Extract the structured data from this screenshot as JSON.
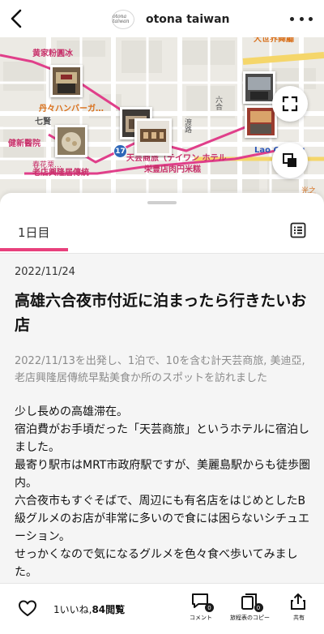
{
  "header": {
    "logo_text": "otona taiwan",
    "brand_name": "otona taiwan"
  },
  "map": {
    "labels": {
      "department_store": "大世界舞廳",
      "chicken_shop": "黄家粉圓冰",
      "burger": "丹々ハンバーガ…",
      "qixian": "七賢",
      "hospital": "健新醫院",
      "cafe_rice": "春花栗…",
      "hotel": "天芸商旅（テイワン ホテル",
      "noodles": "栄豊店肉円米糕",
      "oldshop": "老店興隆居傳統",
      "laochiang": "Lao Chiang",
      "guangzhi": "光之",
      "road": "六合",
      "road2": "渡路"
    },
    "route_number": "17",
    "colors": {
      "route": "#e03f8a",
      "pin": "#2e67b8"
    }
  },
  "sheet": {
    "tab_label": "1日目",
    "date": "2022/11/24",
    "title": "高雄六合夜市付近に泊まったら行きたいお店",
    "summary": "2022/11/13を出発し、1泊で、10を含む計天芸商旅, 美迪亞, 老店興隆居傳統早點美食か所のスポットを訪れました",
    "body_lines": [
      "少し長めの高雄滞在。",
      "宿泊費がお手頃だった「天芸商旅」というホテルに宿泊しました。",
      "最寄り駅市はMRT市政府駅ですが、美麗島駅からも徒歩圏内。",
      "六合夜市もすぐそばで、周辺にも有名店をはじめとしたB級グルメのお店が非常に多いので食には困らないシチュエーション。",
      "せっかくなので気になるグルメを色々食べ歩いてみました。"
    ],
    "accent_color": "#e8407c"
  },
  "bottom_bar": {
    "likes": "1いいね,",
    "views": "84閲覧",
    "comment_label": "コメント",
    "comment_count": "0",
    "copy_label": "旅程表のコピー",
    "copy_count": "0",
    "share_label": "共有"
  }
}
